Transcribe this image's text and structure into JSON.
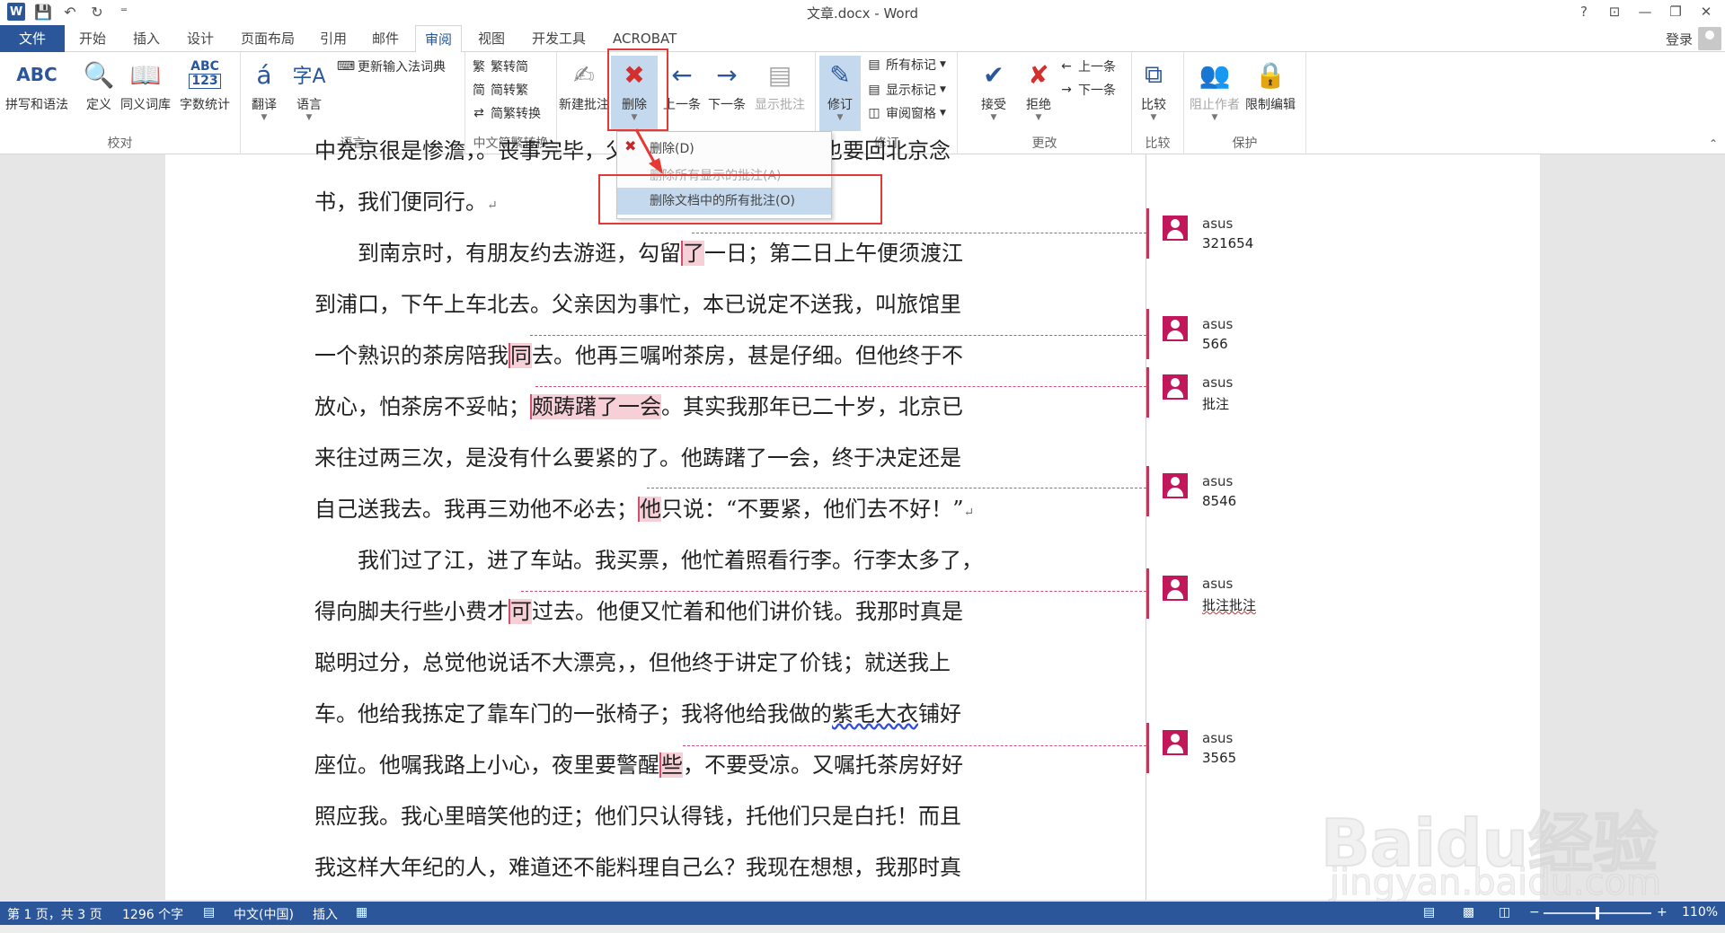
{
  "window": {
    "title": "文章.docx - Word",
    "help": "?",
    "restore_ribbon": "⊡",
    "min": "▭",
    "max": "▢",
    "close": "✕"
  },
  "qat": {
    "logo": "W",
    "customize": "⁼"
  },
  "tabs": [
    "文件",
    "开始",
    "插入",
    "设计",
    "页面布局",
    "引用",
    "邮件",
    "审阅",
    "视图",
    "开发工具",
    "ACROBAT"
  ],
  "active_tab": "审阅",
  "login": "登录",
  "ribbon": {
    "proofing": {
      "label": "校对",
      "spell": "拼写和语法",
      "define": "定义",
      "thesaurus": "同义词库",
      "wordcount": "字数统计"
    },
    "language": {
      "label": "语言",
      "translate": "翻译",
      "language": "语言",
      "update_ime": "更新输入法词典"
    },
    "chinese": {
      "label": "中文简繁转换",
      "t2s": "繁转简",
      "s2t": "简转繁",
      "convert": "简繁转换"
    },
    "comments": {
      "new": "新建批注",
      "delete": "删除",
      "prev": "上一条",
      "next": "下一条",
      "show": "显示批注"
    },
    "tracking": {
      "label": "修订",
      "track": "修订",
      "markup": "所有标记",
      "show_markup": "显示标记",
      "pane": "审阅窗格"
    },
    "changes": {
      "label": "更改",
      "accept": "接受",
      "reject": "拒绝",
      "prev": "上一条",
      "next": "下一条"
    },
    "compare": {
      "label": "比较",
      "compare": "比较"
    },
    "protect": {
      "label": "保护",
      "block": "阻止作者",
      "restrict": "限制编辑"
    },
    "abc_text": "ABC",
    "abc_num": "123",
    "zi_text": "字A"
  },
  "delete_menu": {
    "item1": "删除(D)",
    "item2": "删除所有显示的批注(A)",
    "item3": "删除文档中的所有批注(O)"
  },
  "document": {
    "lines": [
      {
        "parts": [
          {
            "t": "中充京很是惨澹，。丧事完毕，父亲要到南京谋事，我也要回北京念",
            "hl": false
          }
        ]
      },
      {
        "parts": [
          {
            "t": "书，我们便同行。",
            "hl": false
          },
          {
            "t": "↵",
            "p": true
          }
        ]
      },
      {
        "parts": [
          {
            "t": "　　到南京时，有朋友约去游逛，勾留",
            "hl": false
          },
          {
            "t": "了",
            "hl": true
          },
          {
            "t": "一日；第二日上午便须渡江",
            "hl": false
          }
        ]
      },
      {
        "parts": [
          {
            "t": "到浦口，下午上车北去。父亲因为事忙，本已说定不送我，叫旅馆里",
            "hl": false
          }
        ]
      },
      {
        "parts": [
          {
            "t": "一个熟识的茶房陪我",
            "hl": false
          },
          {
            "t": "同",
            "hl": true
          },
          {
            "t": "去。他再三嘱咐茶房，甚是仔细。但他终于不",
            "hl": false
          }
        ]
      },
      {
        "parts": [
          {
            "t": "放心，怕茶房不妥帖；",
            "hl": false
          },
          {
            "t": "颇踌躇了一会",
            "hl": true
          },
          {
            "t": "。其实我那年已二十岁，北京已",
            "hl": false
          }
        ]
      },
      {
        "parts": [
          {
            "t": "来往过两三次，是没有什么要紧的了。他踌躇了一会，终于决定还是",
            "hl": false
          }
        ]
      },
      {
        "parts": [
          {
            "t": "自己送我去。我再三劝他不必去；",
            "hl": false
          },
          {
            "t": "他",
            "hl": true
          },
          {
            "t": "只说：“不要紧，他们去不好！”",
            "hl": false
          },
          {
            "t": "↵",
            "p": true
          }
        ]
      },
      {
        "parts": [
          {
            "t": "　　我们过了江，进了车站。我买票，他忙着照看行李。行李太多了，",
            "hl": false
          }
        ]
      },
      {
        "parts": [
          {
            "t": "得向脚夫行些小费才",
            "hl": false
          },
          {
            "t": "可",
            "hl": true
          },
          {
            "t": "过去。他便又忙着和他们讲价钱。我那时真是",
            "hl": false
          }
        ]
      },
      {
        "parts": [
          {
            "t": "聪明过分，总觉他说话不大漂亮，，但他终于讲定了价钱；就送我上",
            "hl": false
          }
        ]
      },
      {
        "parts": [
          {
            "t": "车。他给我拣定了靠车门的一张椅子；我将他给我做的",
            "hl": false
          },
          {
            "t": "紫毛大衣",
            "w": true
          },
          {
            "t": "铺好",
            "hl": false
          }
        ]
      },
      {
        "parts": [
          {
            "t": "座位。他嘱我路上小心，夜里要警醒",
            "hl": false
          },
          {
            "t": "些",
            "hl": true
          },
          {
            "t": "，不要受凉。又嘱托茶房好好",
            "hl": false
          }
        ]
      },
      {
        "parts": [
          {
            "t": "照应我。我心里暗笑他的迂；他们只认得钱，托他们只是白托！而且",
            "hl": false
          }
        ]
      },
      {
        "parts": [
          {
            "t": "我这样大年纪的人，难道还不能料理自己么？我现在想想，我那时真",
            "hl": false
          }
        ]
      }
    ]
  },
  "comments": [
    {
      "author": "asus",
      "text": "321654"
    },
    {
      "author": "asus",
      "text": "566"
    },
    {
      "author": "asus",
      "text": "批注"
    },
    {
      "author": "asus",
      "text": "8546"
    },
    {
      "author": "asus",
      "text": "批注批注"
    },
    {
      "author": "asus",
      "text": "3565"
    }
  ],
  "status": {
    "page": "第 1 页，共 3 页",
    "words": "1296 个字",
    "lang": "中文(中国)",
    "mode": "插入",
    "zoom": "110%",
    "zoom_minus": "−",
    "zoom_plus": "+"
  },
  "watermark": {
    "big": "Baidu经验",
    "small": "jingyan.baidu.com"
  },
  "colors": {
    "brand": "#2b579a",
    "comment": "#c2185b",
    "highlight": "#f6cfd7",
    "callout": "#e53935"
  }
}
